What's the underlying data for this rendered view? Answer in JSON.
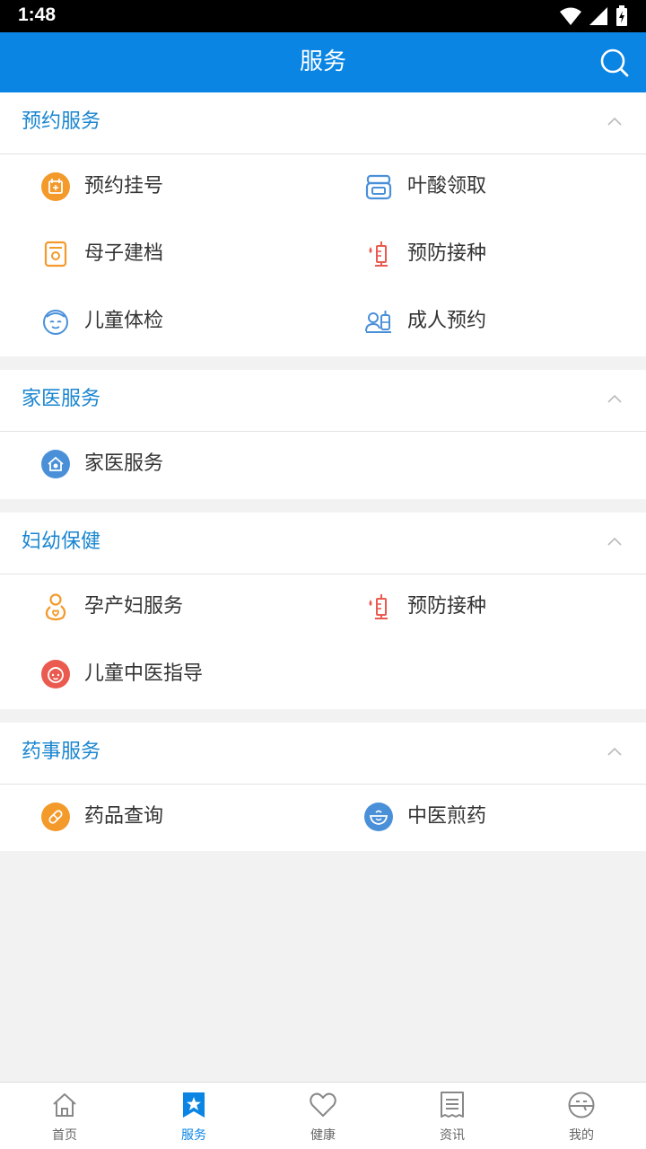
{
  "status_bar": {
    "time": "1:48"
  },
  "header": {
    "title": "服务"
  },
  "sections": [
    {
      "title": "预约服务",
      "items": [
        {
          "label": "预约挂号",
          "icon": "calendar-icon",
          "color": "#f39a2b"
        },
        {
          "label": "叶酸领取",
          "icon": "medicine-bottle-icon",
          "color": "#4a90d9"
        },
        {
          "label": "母子建档",
          "icon": "archive-icon",
          "color": "#f39a2b"
        },
        {
          "label": "预防接种",
          "icon": "syringe-icon",
          "color": "#ea5a4f"
        },
        {
          "label": "儿童体检",
          "icon": "child-face-icon",
          "color": "#4a90d9"
        },
        {
          "label": "成人预约",
          "icon": "adult-vaccine-icon",
          "color": "#4a90d9"
        }
      ]
    },
    {
      "title": "家医服务",
      "items": [
        {
          "label": "家医服务",
          "icon": "family-doctor-icon",
          "color": "#4a90d9"
        }
      ]
    },
    {
      "title": "妇幼保健",
      "items": [
        {
          "label": "孕产妇服务",
          "icon": "pregnant-icon",
          "color": "#f39a2b"
        },
        {
          "label": "预防接种",
          "icon": "syringe-icon",
          "color": "#ea5a4f"
        },
        {
          "label": "儿童中医指导",
          "icon": "child-tcm-icon",
          "color": "#ea5a4f"
        }
      ]
    },
    {
      "title": "药事服务",
      "items": [
        {
          "label": "药品查询",
          "icon": "pill-search-icon",
          "color": "#f39a2b"
        },
        {
          "label": "中医煎药",
          "icon": "herbal-bowl-icon",
          "color": "#4a90d9"
        }
      ]
    }
  ],
  "bottom_nav": [
    {
      "label": "首页",
      "icon": "home-icon",
      "active": false
    },
    {
      "label": "服务",
      "icon": "star-bookmark-icon",
      "active": true
    },
    {
      "label": "健康",
      "icon": "heart-icon",
      "active": false
    },
    {
      "label": "资讯",
      "icon": "news-icon",
      "active": false
    },
    {
      "label": "我的",
      "icon": "profile-icon",
      "active": false
    }
  ],
  "colors": {
    "primary": "#0a85e4",
    "section_title": "#1a86d0",
    "background": "#f2f2f2"
  }
}
